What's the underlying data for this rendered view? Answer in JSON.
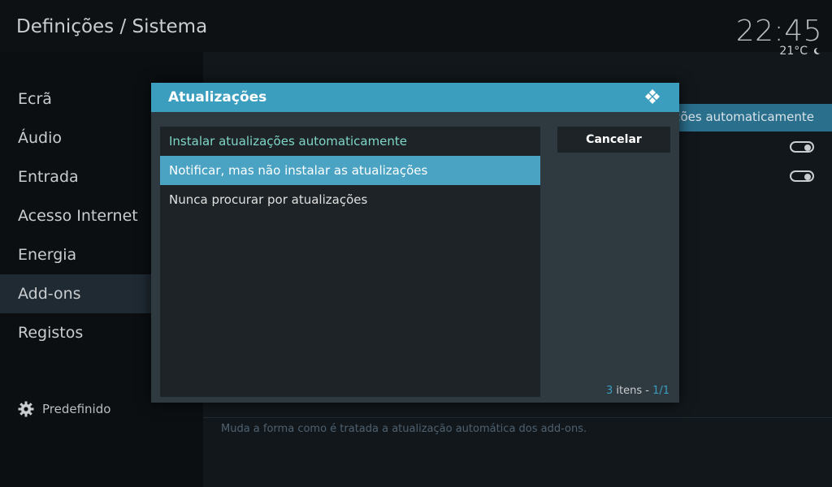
{
  "header": {
    "title": "Definições / Sistema"
  },
  "clock": {
    "time": "22:45",
    "temperature": "21°C",
    "weather_icon": "moon-icon"
  },
  "sidebar": {
    "items": [
      {
        "label": "Ecrã"
      },
      {
        "label": "Áudio"
      },
      {
        "label": "Entrada"
      },
      {
        "label": "Acesso Internet"
      },
      {
        "label": "Energia"
      },
      {
        "label": "Add-ons"
      },
      {
        "label": "Registos"
      }
    ],
    "active_index": 5,
    "footer_label": "Predefinido",
    "footer_icon": "gear-icon"
  },
  "content": {
    "highlight_row_label": "ções automaticamente",
    "description": "Muda a forma como é tratada a atualização automática dos add-ons."
  },
  "dialog": {
    "title": "Atualizações",
    "logo_icon": "kodi-logo-icon",
    "options": [
      {
        "label": "Instalar atualizações automaticamente"
      },
      {
        "label": "Notificar, mas não instalar as atualizações"
      },
      {
        "label": "Nunca procurar por atualizações"
      }
    ],
    "selected_value_index": 0,
    "focused_index": 1,
    "cancel_label": "Cancelar",
    "items_count": "3",
    "items_word": " itens - ",
    "page": "1/1"
  },
  "colors": {
    "accent": "#3c9ebf",
    "highlight_row": "#2a6f8c",
    "selected_value_text": "#7fd6c7"
  }
}
